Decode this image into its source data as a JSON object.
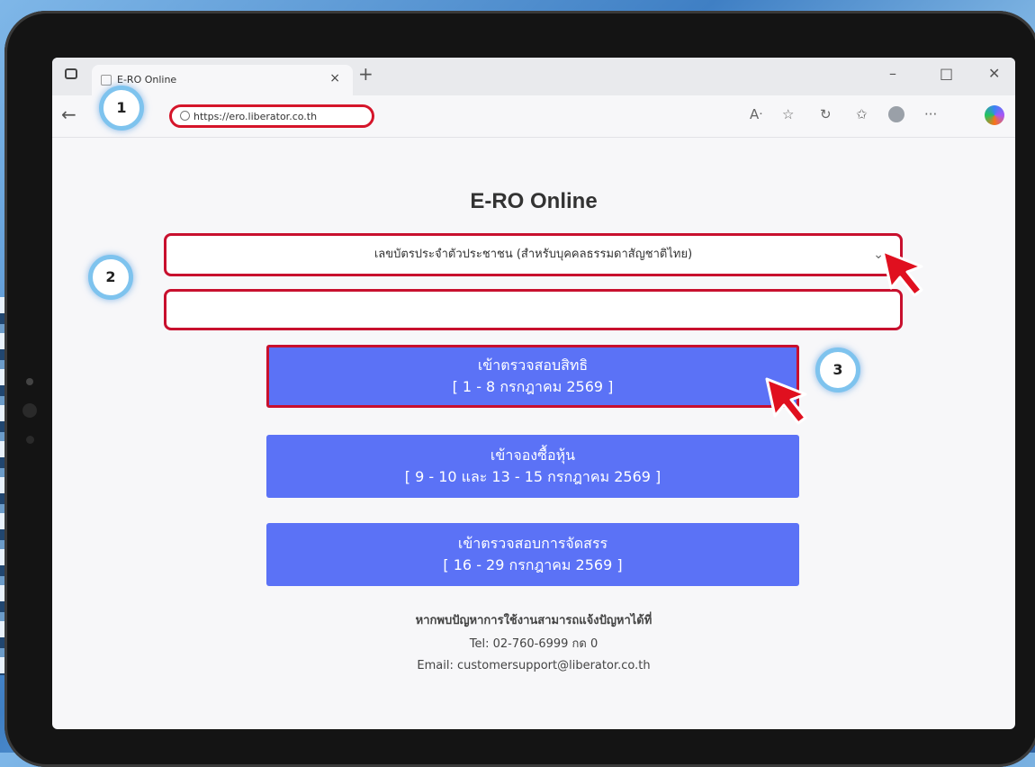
{
  "browser": {
    "tab_title": "E-RO Online",
    "tab_close": "×",
    "new_tab": "+",
    "url": "https://ero.liberator.co.th",
    "window_controls": {
      "minimize": "–",
      "maximize": "□",
      "close": "✕"
    },
    "toolbar_icons": [
      "read-aloud-icon",
      "favorite-star-icon",
      "refresh-icon",
      "favorites-icon",
      "profile-icon",
      "more-icon",
      "copilot-icon"
    ]
  },
  "page": {
    "title": "E-RO Online",
    "id_type_select": {
      "value": "เลขบัตรประจำตัวประชาชน (สำหรับบุคคลธรรมดาสัญชาติไทย)",
      "chevron": "⌄"
    },
    "id_input": {
      "value": ""
    },
    "buttons": [
      {
        "line1": "เข้าตรวจสอบสิทธิ",
        "line2": "[ 1 - 8 กรกฎาคม 2569 ]"
      },
      {
        "line1": "เข้าจองซื้อหุ้น",
        "line2": "[ 9 - 10 และ 13 - 15 กรกฎาคม 2569 ]"
      },
      {
        "line1": "เข้าตรวจสอบการจัดสรร",
        "line2": "[ 16 - 29 กรกฎาคม 2569 ]"
      }
    ],
    "contact": {
      "heading": "หากพบปัญหาการใช้งานสามารถแจ้งปัญหาได้ที่",
      "tel": "Tel: 02-760-6999 กด 0",
      "email": "Email: customersupport@liberator.co.th"
    }
  },
  "annotations": {
    "step1": "1",
    "step2": "2",
    "step3": "3"
  },
  "colors": {
    "button": "#5b72f6",
    "highlight": "#c8102e",
    "badge_ring": "#7ec3ee"
  }
}
